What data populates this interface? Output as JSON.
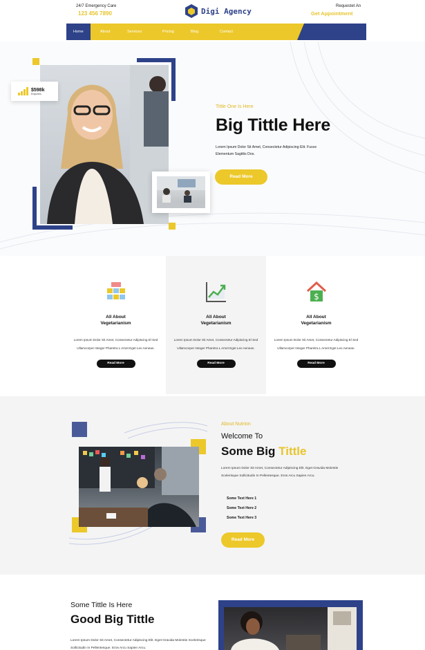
{
  "topbar": {
    "care_label": "24/7 Emergency Care",
    "phone": "123 456 7890",
    "brand": "Digi Agency",
    "request_label": "Requestet An",
    "appointment_link": "Get Appointment"
  },
  "nav": {
    "items": [
      "Home",
      "About",
      "Services",
      "Pricing",
      "Blog",
      "Contact"
    ],
    "active": "Home"
  },
  "hero": {
    "stat_value": "$598k",
    "stat_label": "Enquiries",
    "kicker": "Tittle One Is Here",
    "title": "Big Tittle Here",
    "text": "Lorem Ipsum Dolor Sit Amet, Consectetur Adipiscing Elit. Fusce Elementum Sagittis Dos.",
    "button": "Read More"
  },
  "features": [
    {
      "icon": "blocks-icon",
      "title_line1": "All About",
      "title_line2": "Vegetarianism",
      "text": "Lorem Ipsum Dolor Sit Amet, Consectetur Adipiscing El Sed Ullamcorper Integer Pharetra L Amet Eget Leo Aenean.",
      "button": "Read More"
    },
    {
      "icon": "growth-chart-icon",
      "title_line1": "All About",
      "title_line2": "Vegetarianism",
      "text": "Lorem Ipsum Dolor Sit Amet, Consectetur Adipiscing El Sed Ullamcorper Integer Pharetra L Amet Eget Leo Aenean.",
      "button": "Read More"
    },
    {
      "icon": "house-dollar-icon",
      "title_line1": "All About",
      "title_line2": "Vegetarianism",
      "text": "Lorem Ipsum Dolor Sit Amet, Consectetur Adipiscing El Sed Ullamcorper Integer Pharetra L Amet Eget Leo Aenean.",
      "button": "Read More"
    }
  ],
  "about": {
    "kicker": "About Nutrion",
    "welcome": "Welcome To",
    "title_plain": "Some Big",
    "title_highlight": "Tittle",
    "text": "Lorem Ipsum Dolor Sit Amet, Consectetur Adipiscing Elit. Eget Gravida Molestie Scelerisque Sollicitudin In Pellentesque. Eros Arcu Sapien Arcu.",
    "list": [
      "Some Text Here 1",
      "Some Text Here 2",
      "Some Text Here 3"
    ],
    "button": "Read More"
  },
  "bottom": {
    "kicker": "Some Tittle Is Here",
    "title": "Good Big Tittle",
    "text": "Lorem Ipsum Dolor Sit Amet, Consectetur Adipiscing Elit. Eget Gravida Molestie Scelerisque Sollicitudin In Pellentesque. Eros Arcu Sapien Arcu."
  },
  "colors": {
    "accent_yellow": "#ecc82a",
    "brand_blue": "#2d4289"
  }
}
